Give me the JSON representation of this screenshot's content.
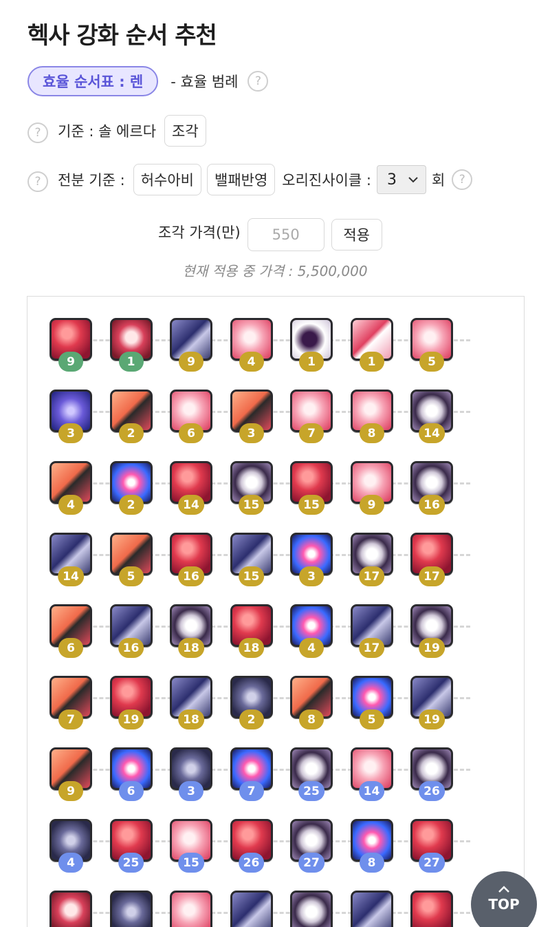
{
  "title": "헥사 강화 순서 추천",
  "efficiency": {
    "pill_label": "효율 순서표 : 렌",
    "legend_text": "- 효율 범례"
  },
  "criteria": {
    "label": "기준 : 솔 에르다",
    "button": "조각"
  },
  "ratio": {
    "label": "전분 기준 :",
    "buttons": [
      "허수아비",
      "밸패반영"
    ],
    "cycle_label": "오리진사이클 :",
    "cycle_value": "3",
    "cycle_unit": "회"
  },
  "price": {
    "label": "조각 가격(만)",
    "placeholder": "550",
    "apply_button": "적용",
    "current_text": "현재 적용 중 가격 : 5,500,000"
  },
  "help_glyph": "?",
  "top_button": {
    "arrow": "^",
    "label": "TOP"
  },
  "badge_colors": {
    "green": "#5aa874",
    "gold": "#c7a52a",
    "blue": "#6f8fec"
  },
  "skill_grid": [
    [
      {
        "icon": "red-flame-skill-icon",
        "level": "9",
        "color": "green"
      },
      {
        "icon": "crimson-tree-skill-icon",
        "level": "1",
        "color": "green"
      },
      {
        "icon": "blue-blade-skill-icon",
        "level": "9",
        "color": "gold"
      },
      {
        "icon": "pink-burst-skill-icon",
        "level": "4",
        "color": "gold"
      },
      {
        "icon": "dark-ninja-skill-icon",
        "level": "1",
        "color": "gold"
      },
      {
        "icon": "crimson-slash-skill-icon",
        "level": "1",
        "color": "gold"
      },
      {
        "icon": "pink-burst-skill-icon",
        "level": "5",
        "color": "gold"
      }
    ],
    [
      {
        "icon": "galaxy-skill-icon",
        "level": "3",
        "color": "gold"
      },
      {
        "icon": "fire-axe-skill-icon",
        "level": "2",
        "color": "gold"
      },
      {
        "icon": "pink-burst-skill-icon",
        "level": "6",
        "color": "gold"
      },
      {
        "icon": "fire-axe-skill-icon",
        "level": "3",
        "color": "gold"
      },
      {
        "icon": "pink-burst-skill-icon",
        "level": "7",
        "color": "gold"
      },
      {
        "icon": "pink-burst-skill-icon",
        "level": "8",
        "color": "gold"
      },
      {
        "icon": "dark-orb-skill-icon",
        "level": "14",
        "color": "gold"
      }
    ],
    [
      {
        "icon": "fire-axe-skill-icon",
        "level": "4",
        "color": "gold"
      },
      {
        "icon": "blue-eye-skill-icon",
        "level": "2",
        "color": "gold"
      },
      {
        "icon": "red-flame-skill-icon",
        "level": "14",
        "color": "gold"
      },
      {
        "icon": "dark-orb-skill-icon",
        "level": "15",
        "color": "gold"
      },
      {
        "icon": "red-flame-skill-icon",
        "level": "15",
        "color": "gold"
      },
      {
        "icon": "pink-burst-skill-icon",
        "level": "9",
        "color": "gold"
      },
      {
        "icon": "dark-orb-skill-icon",
        "level": "16",
        "color": "gold"
      }
    ],
    [
      {
        "icon": "blue-blade-skill-icon",
        "level": "14",
        "color": "gold"
      },
      {
        "icon": "fire-axe-skill-icon",
        "level": "5",
        "color": "gold"
      },
      {
        "icon": "red-flame-skill-icon",
        "level": "16",
        "color": "gold"
      },
      {
        "icon": "blue-blade-skill-icon",
        "level": "15",
        "color": "gold"
      },
      {
        "icon": "blue-eye-skill-icon",
        "level": "3",
        "color": "gold"
      },
      {
        "icon": "dark-orb-skill-icon",
        "level": "17",
        "color": "gold"
      },
      {
        "icon": "red-flame-skill-icon",
        "level": "17",
        "color": "gold"
      }
    ],
    [
      {
        "icon": "fire-axe-skill-icon",
        "level": "6",
        "color": "gold"
      },
      {
        "icon": "blue-blade-skill-icon",
        "level": "16",
        "color": "gold"
      },
      {
        "icon": "dark-orb-skill-icon",
        "level": "18",
        "color": "gold"
      },
      {
        "icon": "red-flame-skill-icon",
        "level": "18",
        "color": "gold"
      },
      {
        "icon": "blue-eye-skill-icon",
        "level": "4",
        "color": "gold"
      },
      {
        "icon": "blue-blade-skill-icon",
        "level": "17",
        "color": "gold"
      },
      {
        "icon": "dark-orb-skill-icon",
        "level": "19",
        "color": "gold"
      }
    ],
    [
      {
        "icon": "fire-axe-skill-icon",
        "level": "7",
        "color": "gold"
      },
      {
        "icon": "red-flame-skill-icon",
        "level": "19",
        "color": "gold"
      },
      {
        "icon": "blue-blade-skill-icon",
        "level": "18",
        "color": "gold"
      },
      {
        "icon": "sigil-skill-icon",
        "level": "2",
        "color": "gold"
      },
      {
        "icon": "fire-axe-skill-icon",
        "level": "8",
        "color": "gold"
      },
      {
        "icon": "blue-eye-skill-icon",
        "level": "5",
        "color": "gold"
      },
      {
        "icon": "blue-blade-skill-icon",
        "level": "19",
        "color": "gold"
      }
    ],
    [
      {
        "icon": "fire-axe-skill-icon",
        "level": "9",
        "color": "gold"
      },
      {
        "icon": "blue-eye-skill-icon",
        "level": "6",
        "color": "blue"
      },
      {
        "icon": "sigil-skill-icon",
        "level": "3",
        "color": "blue"
      },
      {
        "icon": "blue-eye-skill-icon",
        "level": "7",
        "color": "blue"
      },
      {
        "icon": "dark-orb-skill-icon",
        "level": "25",
        "color": "blue"
      },
      {
        "icon": "pink-burst-skill-icon",
        "level": "14",
        "color": "blue"
      },
      {
        "icon": "dark-orb-skill-icon",
        "level": "26",
        "color": "blue"
      }
    ],
    [
      {
        "icon": "sigil-skill-icon",
        "level": "4",
        "color": "blue"
      },
      {
        "icon": "red-flame-skill-icon",
        "level": "25",
        "color": "blue"
      },
      {
        "icon": "pink-burst-skill-icon",
        "level": "15",
        "color": "blue"
      },
      {
        "icon": "red-flame-skill-icon",
        "level": "26",
        "color": "blue"
      },
      {
        "icon": "dark-orb-skill-icon",
        "level": "27",
        "color": "blue"
      },
      {
        "icon": "blue-eye-skill-icon",
        "level": "8",
        "color": "blue"
      },
      {
        "icon": "red-flame-skill-icon",
        "level": "27",
        "color": "blue"
      }
    ],
    [
      {
        "icon": "crimson-tree-skill-icon",
        "level": "",
        "color": "blue"
      },
      {
        "icon": "sigil-skill-icon",
        "level": "",
        "color": "blue"
      },
      {
        "icon": "pink-burst-skill-icon",
        "level": "",
        "color": "blue"
      },
      {
        "icon": "blue-blade-skill-icon",
        "level": "",
        "color": "blue"
      },
      {
        "icon": "dark-orb-skill-icon",
        "level": "",
        "color": "blue"
      },
      {
        "icon": "blue-blade-skill-icon",
        "level": "",
        "color": "blue"
      },
      {
        "icon": "red-flame-skill-icon",
        "level": "",
        "color": "blue"
      }
    ]
  ]
}
